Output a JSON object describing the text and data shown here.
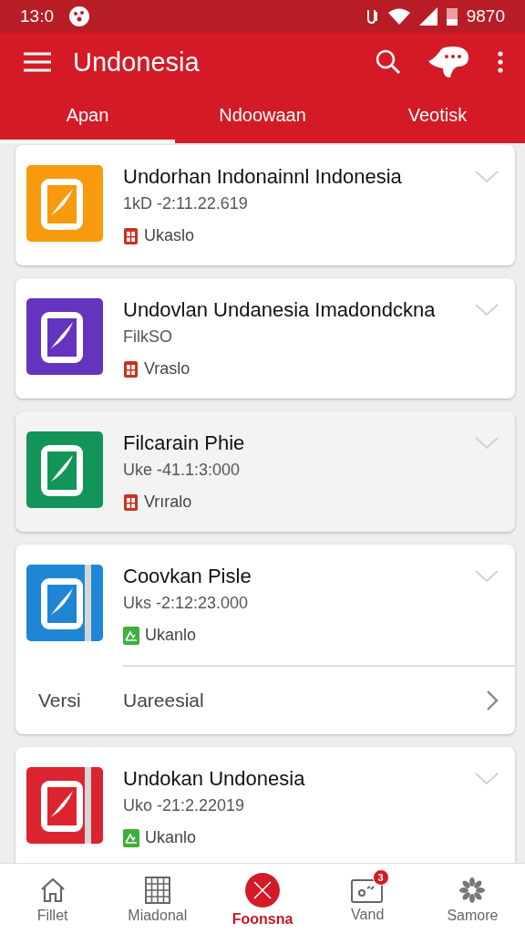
{
  "status_bar": {
    "time": "13:0",
    "battery": "9870"
  },
  "app_bar": {
    "title": "Undonesia"
  },
  "tabs": [
    {
      "label": "Apan",
      "selected": true
    },
    {
      "label": "Ndoowaan",
      "selected": false
    },
    {
      "label": "Veotisk",
      "selected": false
    }
  ],
  "apps": [
    {
      "title": "Undorhan Indonainnl Indonesia",
      "subtitle": "1kD -2:11.22.619",
      "tag": "Ukaslo",
      "kind": "store",
      "color": "#f79a0d",
      "stripe": false,
      "selected": false
    },
    {
      "title": "Undovlan Undanesia Imadondckna",
      "subtitle": "FilkSO",
      "tag": "Vraslo",
      "kind": "store",
      "color": "#6434be",
      "stripe": false,
      "selected": false
    },
    {
      "title": "Filcarain Phie",
      "subtitle": "Uke -41.1:3:000",
      "tag": "Vrıralo",
      "kind": "store",
      "color": "#13955a",
      "stripe": false,
      "selected": true
    },
    {
      "title": "Coovkan Pisle",
      "subtitle": "Uks -2:12:23.000",
      "tag": "Ukanlo",
      "kind": "chart",
      "color": "#1f86d6",
      "stripe": true,
      "selected": false,
      "detail": {
        "label": "Versi",
        "value": "Uareesial"
      }
    },
    {
      "title": "Undokan Undonesia",
      "subtitle": "Uko -21:2.22019",
      "tag": "Ukanlo",
      "kind": "chart",
      "color": "#dc2430",
      "stripe": true,
      "selected": false
    }
  ],
  "bottom_nav": [
    {
      "label": "Fillet",
      "kind": "home",
      "selected": false
    },
    {
      "label": "Miadonal",
      "kind": "grid",
      "selected": false
    },
    {
      "label": "Foonsna",
      "kind": "close",
      "selected": true
    },
    {
      "label": "Vand",
      "kind": "card",
      "selected": false,
      "badge": "3"
    },
    {
      "label": "Samore",
      "kind": "flower",
      "selected": false
    }
  ]
}
